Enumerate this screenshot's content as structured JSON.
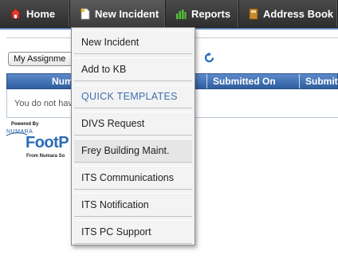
{
  "nav": {
    "home": {
      "label": "Home",
      "icon": "house-icon"
    },
    "new_incident": {
      "label": "New Incident",
      "icon": "document-icon"
    },
    "reports": {
      "label": "Reports",
      "icon": "bar-chart-icon"
    },
    "address_book": {
      "label": "Address Book",
      "icon": "book-icon"
    }
  },
  "toolbar": {
    "assignment_select": "My Assignme",
    "refresh_icon": "refresh-icon"
  },
  "table": {
    "headers": [
      "Num",
      "Submitted On",
      "Submitt"
    ],
    "empty_message": "You do not hav"
  },
  "branding": {
    "powered_by": "Powered By",
    "numara": "NUMARA",
    "footprints": "FootP",
    "from": "From Numara So"
  },
  "dropdown": {
    "items": [
      {
        "label": "New Incident",
        "type": "item"
      },
      {
        "label": "Add to KB",
        "type": "item"
      },
      {
        "label": "QUICK TEMPLATES",
        "type": "header"
      },
      {
        "label": "DIVS Request",
        "type": "item"
      },
      {
        "label": "Frey Building Maint.",
        "type": "item"
      },
      {
        "label": "ITS Communications",
        "type": "item"
      },
      {
        "label": "ITS Notification",
        "type": "item"
      },
      {
        "label": "ITS PC Support",
        "type": "item"
      }
    ]
  },
  "colors": {
    "nav_background": "#3a3a3a",
    "table_header": "#4a78bb",
    "menu_header_text": "#3f6fb0",
    "accent_rule": "#5b84b6"
  }
}
